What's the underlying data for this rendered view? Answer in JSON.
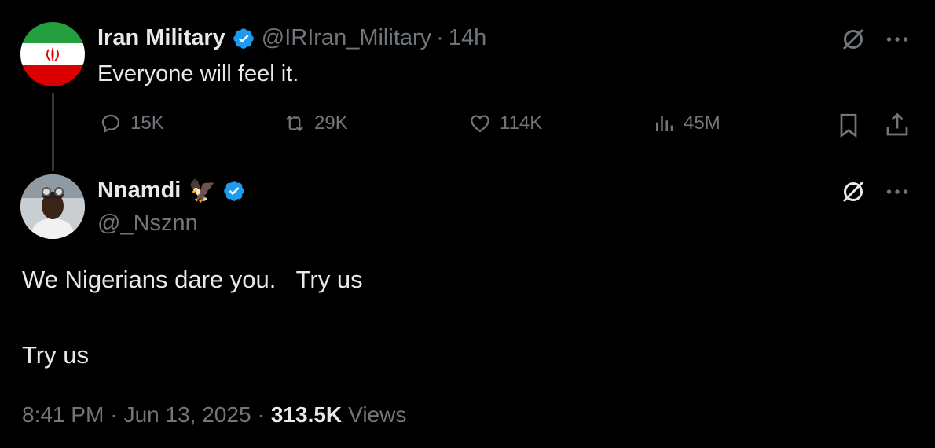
{
  "parent": {
    "name": "Iran Military",
    "handle": "@IRIran_Military",
    "separator": "·",
    "time": "14h",
    "text": "Everyone will feel it.",
    "stats": {
      "replies": "15K",
      "reposts": "29K",
      "likes": "114K",
      "views": "45M"
    }
  },
  "reply": {
    "name": "Nnamdi",
    "name_emoji": "🦅",
    "handle": "@_Nsznn",
    "text_line1": "We Nigerians dare you.   Try us",
    "text_line2": "Try us",
    "time": "8:41 PM",
    "separator1": "·",
    "date": "Jun 13, 2025",
    "separator2": "·",
    "views_count": "313.5K",
    "views_label": "Views"
  },
  "colors": {
    "background": "#000000",
    "primary_text": "#e7e9ea",
    "secondary_text": "#71767b",
    "verified_blue": "#1d9bf0"
  },
  "icons": {
    "verified": "verified-badge-icon",
    "grok": "grok-icon",
    "more": "more-icon",
    "reply": "reply-icon",
    "repost": "repost-icon",
    "like": "like-icon",
    "views": "views-icon",
    "bookmark": "bookmark-icon",
    "share": "share-icon"
  }
}
